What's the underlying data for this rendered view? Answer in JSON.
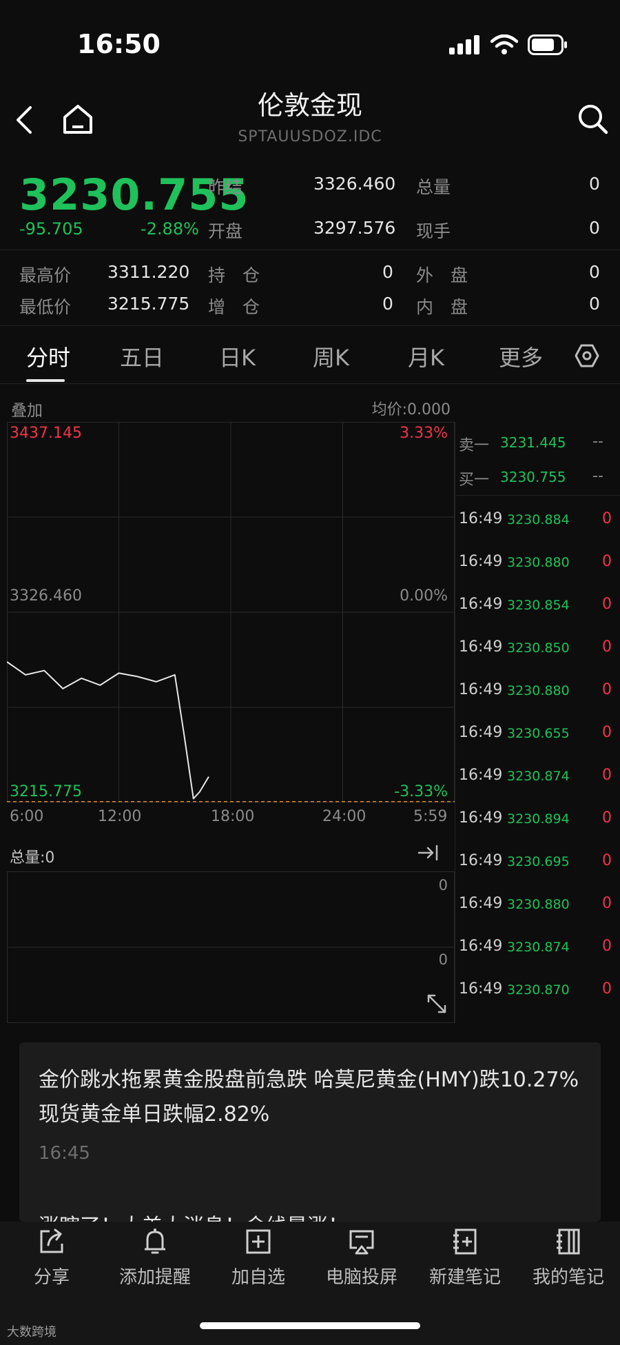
{
  "status": {
    "time": "16:50"
  },
  "header": {
    "title": "伦敦金现",
    "subtitle": "SPTAUUSDOZ.IDC"
  },
  "quote": {
    "price": "3230.755",
    "change": "-95.705",
    "change_pct": "-2.88%",
    "fields": {
      "prev_settle_label": "昨结",
      "prev_settle": "3326.460",
      "total_vol_label": "总量",
      "total_vol": "0",
      "open_label": "开盘",
      "open": "3297.576",
      "cur_hand_label": "现手",
      "cur_hand": "0",
      "high_label": "最高价",
      "high": "3311.220",
      "hold_label": "持　仓",
      "hold": "0",
      "outer_label": "外　盘",
      "outer": "0",
      "low_label": "最低价",
      "low": "3215.775",
      "add_label": "增　仓",
      "add": "0",
      "inner_label": "内　盘",
      "inner": "0"
    }
  },
  "tabs": [
    "分时",
    "五日",
    "日K",
    "周K",
    "月K",
    "更多"
  ],
  "chart_header": {
    "overlay": "叠加",
    "avg": "均价:0.000"
  },
  "chart": {
    "top_price": "3437.145",
    "top_pct": "3.33%",
    "mid_price": "3326.460",
    "mid_pct": "0.00%",
    "bottom_price": "3215.775",
    "bottom_pct": "-3.33%",
    "x_labels": [
      "6:00",
      "12:00",
      "18:00",
      "24:00",
      "5:59"
    ]
  },
  "chart_data": {
    "type": "line",
    "title": "",
    "ylim": [
      3215.775,
      3437.145
    ],
    "x": [
      "6:00",
      "7:00",
      "8:00",
      "9:00",
      "10:00",
      "11:00",
      "12:00",
      "13:00",
      "14:00",
      "15:00",
      "15:30",
      "16:00",
      "16:20",
      "16:49"
    ],
    "series": [
      {
        "values": [
          3297.6,
          3290.0,
          3292.5,
          3282.0,
          3288.0,
          3284.0,
          3291.0,
          3289.0,
          3286.0,
          3290.0,
          3255.0,
          3218.0,
          3222.0,
          3230.755
        ]
      }
    ]
  },
  "volume": {
    "label": "总量:0",
    "top_val": "0",
    "mid_val": "0"
  },
  "order_book": {
    "sell_label": "卖一",
    "sell_price": "3231.445",
    "sell_vol": "--",
    "buy_label": "买一",
    "buy_price": "3230.755",
    "buy_vol": "--"
  },
  "ticks": [
    {
      "time": "16:49",
      "price": "3230.884",
      "vol": "0"
    },
    {
      "time": "16:49",
      "price": "3230.880",
      "vol": "0"
    },
    {
      "time": "16:49",
      "price": "3230.854",
      "vol": "0"
    },
    {
      "time": "16:49",
      "price": "3230.850",
      "vol": "0"
    },
    {
      "time": "16:49",
      "price": "3230.880",
      "vol": "0"
    },
    {
      "time": "16:49",
      "price": "3230.655",
      "vol": "0"
    },
    {
      "time": "16:49",
      "price": "3230.874",
      "vol": "0"
    },
    {
      "time": "16:49",
      "price": "3230.894",
      "vol": "0"
    },
    {
      "time": "16:49",
      "price": "3230.695",
      "vol": "0"
    },
    {
      "time": "16:49",
      "price": "3230.880",
      "vol": "0"
    },
    {
      "time": "16:49",
      "price": "3230.874",
      "vol": "0"
    },
    {
      "time": "16:49",
      "price": "3230.870",
      "vol": "0"
    }
  ],
  "news": {
    "headline": "金价跳水拖累黄金股盘前急跌 哈莫尼黄金(HMY)跌10.27% 现货黄金单日跌幅2.82%",
    "time": "16:45",
    "next_headline": "涨瞎了！大美大消息！金线暴涨！"
  },
  "toolbar": [
    "分享",
    "添加提醒",
    "加自选",
    "电脑投屏",
    "新建笔记",
    "我的笔记"
  ],
  "watermark": "大数跨境"
}
